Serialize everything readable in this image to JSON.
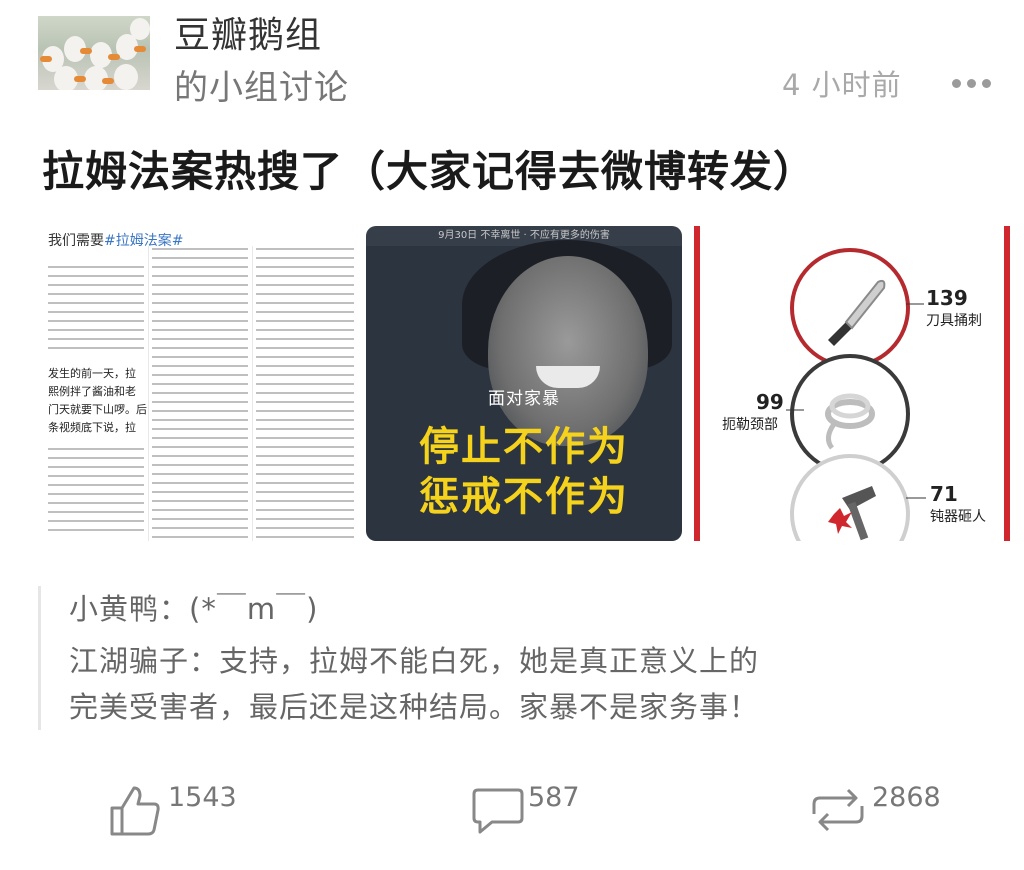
{
  "header": {
    "group_name": "豆瓣鹅组",
    "group_subtitle": "的小组讨论",
    "time_ago": "4 小时前"
  },
  "post": {
    "title": "拉姆法案热搜了（大家记得去微博转发）"
  },
  "images": {
    "image1": {
      "heading": "我们需要",
      "hashtag": "#拉姆法案#",
      "lines": [
        "发生的前一天，拉",
        "熙例拌了酱油和老",
        "门天就要下山啰。后",
        "条视频底下说，拉"
      ]
    },
    "image2": {
      "banner": "9月30日 不幸离世 · 不应有更多的伤害",
      "caption": "面对家暴",
      "line1": "停止不作为",
      "line2": "惩戒不作为"
    },
    "image3": {
      "stats": [
        {
          "num": "139",
          "label": "刀具捅刺",
          "icon": "knife-icon"
        },
        {
          "num": "99",
          "label": "扼勒颈部",
          "icon": "rope-icon"
        },
        {
          "num": "71",
          "label": "钝器砸人",
          "icon": "blunt-weapon-icon"
        }
      ]
    }
  },
  "comments": [
    {
      "author": "小黄鸭",
      "text": "(*￣m￣)"
    },
    {
      "author": "江湖骗子",
      "text_line1": "支持，拉姆不能白死，她是真正意义上的",
      "text_line2": "完美受害者，最后还是这种结局。家暴不是家务事！"
    }
  ],
  "actions": {
    "likes": "1543",
    "comments": "587",
    "reposts": "2868"
  },
  "colors": {
    "accent_red": "#d0262e",
    "highlight_yellow": "#f5d21c",
    "muted_text": "#777777"
  }
}
